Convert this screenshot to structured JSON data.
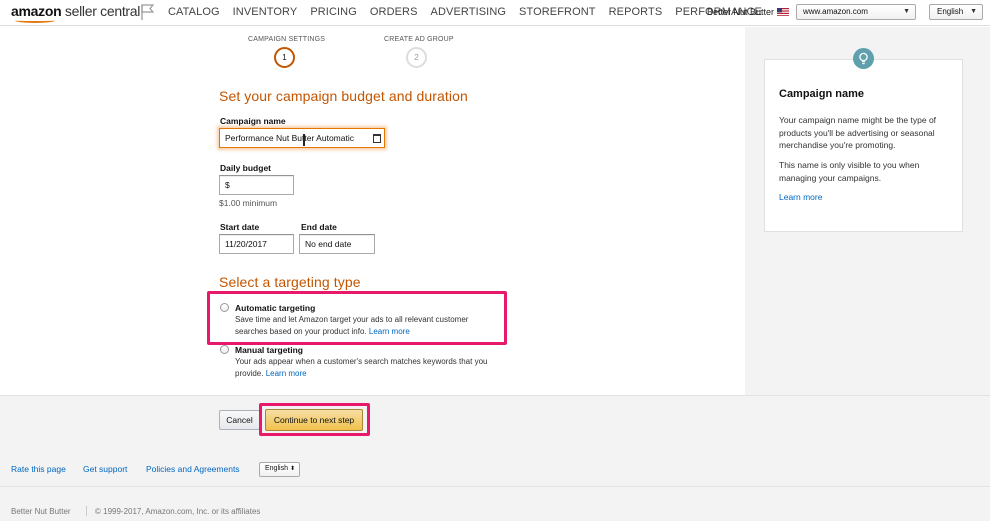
{
  "nav": {
    "logo_bold": "amazon",
    "logo_rest": " seller central",
    "links": [
      "CATALOG",
      "INVENTORY",
      "PRICING",
      "ORDERS",
      "ADVERTISING",
      "STOREFRONT",
      "REPORTS",
      "PERFORMANCE"
    ],
    "seller_name": "Better Nut Butter",
    "marketplace": "www.amazon.com",
    "language": "English"
  },
  "stepper": {
    "step1_label": "CAMPAIGN SETTINGS",
    "step1_number": "1",
    "step2_label": "CREATE AD GROUP",
    "step2_number": "2"
  },
  "form": {
    "heading": "Set your campaign budget and duration",
    "campaign_name_label": "Campaign name",
    "campaign_name_value": "Performance Nut Butter Automatic",
    "daily_budget_label": "Daily budget",
    "daily_budget_value": "$",
    "daily_budget_hint": "$1.00 minimum",
    "start_date_label": "Start date",
    "start_date_value": "11/20/2017",
    "end_date_label": "End date",
    "end_date_value": "No end date"
  },
  "targeting": {
    "heading": "Select a targeting type",
    "auto_title": "Automatic targeting",
    "auto_desc_1": "Save time and let Amazon target your ads to all relevant customer",
    "auto_desc_2": "searches based on your product info.",
    "auto_link": "Learn more",
    "manual_title": "Manual targeting",
    "manual_desc_1": "Your ads appear when a customer's search matches keywords that you",
    "manual_desc_2": "provide.",
    "manual_link": "Learn more"
  },
  "help": {
    "title": "Campaign name",
    "p1": "Your campaign name might be the type of products you'll be advertising or seasonal merchandise you're promoting.",
    "p2": "This name is only visible to you when managing your campaigns.",
    "link": "Learn more"
  },
  "actions": {
    "cancel": "Cancel",
    "continue": "Continue to next step"
  },
  "footer": {
    "rate": "Rate this page",
    "support": "Get support",
    "policies": "Policies and Agreements",
    "language": "English",
    "seller": "Better Nut Butter",
    "copyright": "© 1999-2017, Amazon.com, Inc. or its affiliates"
  },
  "colors": {
    "accent_orange": "#c45500",
    "link_blue": "#0066c0",
    "highlight_pink": "#e8196b",
    "primary_button": "#f0c14b"
  }
}
